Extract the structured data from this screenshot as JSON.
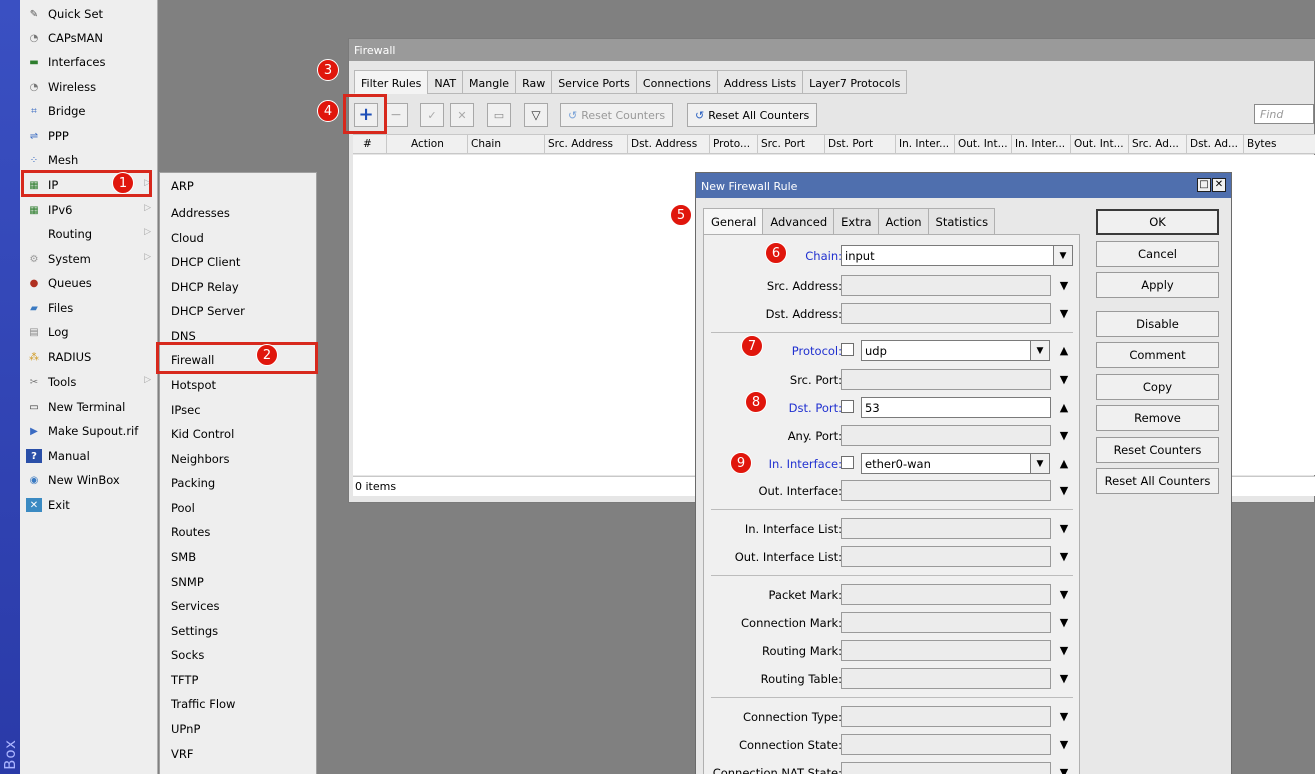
{
  "app": {
    "vertical_label": "Box"
  },
  "main_menu": [
    {
      "label": "Quick Set",
      "icon": "quick-set-icon",
      "glyph": "✎",
      "arrow": false
    },
    {
      "label": "CAPsMAN",
      "icon": "capsman-icon",
      "glyph": "◔",
      "arrow": false
    },
    {
      "label": "Interfaces",
      "icon": "interfaces-icon",
      "glyph": "▬",
      "arrow": false
    },
    {
      "label": "Wireless",
      "icon": "wireless-icon",
      "glyph": "◔",
      "arrow": false
    },
    {
      "label": "Bridge",
      "icon": "bridge-icon",
      "glyph": "⌗",
      "arrow": false
    },
    {
      "label": "PPP",
      "icon": "ppp-icon",
      "glyph": "⇌",
      "arrow": false
    },
    {
      "label": "Mesh",
      "icon": "mesh-icon",
      "glyph": "⁘",
      "arrow": false
    },
    {
      "label": "IP",
      "icon": "ip-icon",
      "glyph": "▦",
      "arrow": true
    },
    {
      "label": "IPv6",
      "icon": "ipv6-icon",
      "glyph": "▦",
      "arrow": true
    },
    {
      "label": "Routing",
      "icon": "",
      "glyph": "",
      "arrow": true
    },
    {
      "label": "System",
      "icon": "system-icon",
      "glyph": "⚙",
      "arrow": true
    },
    {
      "label": "Queues",
      "icon": "queues-icon",
      "glyph": "●",
      "arrow": false
    },
    {
      "label": "Files",
      "icon": "files-icon",
      "glyph": "▰",
      "arrow": false
    },
    {
      "label": "Log",
      "icon": "log-icon",
      "glyph": "▤",
      "arrow": false
    },
    {
      "label": "RADIUS",
      "icon": "radius-icon",
      "glyph": "⁂",
      "arrow": false
    },
    {
      "label": "Tools",
      "icon": "tools-icon",
      "glyph": "✂",
      "arrow": true
    },
    {
      "label": "New Terminal",
      "icon": "terminal-icon",
      "glyph": "▭",
      "arrow": false
    },
    {
      "label": "Make Supout.rif",
      "icon": "supout-icon",
      "glyph": "▶",
      "arrow": false
    },
    {
      "label": "Manual",
      "icon": "manual-icon",
      "glyph": "?",
      "arrow": false
    },
    {
      "label": "New WinBox",
      "icon": "winbox-icon",
      "glyph": "◉",
      "arrow": false
    },
    {
      "label": "Exit",
      "icon": "exit-icon",
      "glyph": "✕",
      "arrow": false
    }
  ],
  "ip_submenu": [
    "ARP",
    "Addresses",
    "Cloud",
    "DHCP Client",
    "DHCP Relay",
    "DHCP Server",
    "DNS",
    "Firewall",
    "Hotspot",
    "IPsec",
    "Kid Control",
    "Neighbors",
    "Packing",
    "Pool",
    "Routes",
    "SMB",
    "SNMP",
    "Services",
    "Settings",
    "Socks",
    "TFTP",
    "Traffic Flow",
    "UPnP",
    "VRF"
  ],
  "firewall": {
    "title": "Firewall",
    "tabs": [
      "Filter Rules",
      "NAT",
      "Mangle",
      "Raw",
      "Service Ports",
      "Connections",
      "Address Lists",
      "Layer7 Protocols"
    ],
    "reset_counters": "Reset Counters",
    "reset_all_counters": "Reset All Counters",
    "find_placeholder": "Find",
    "columns": [
      "#",
      "Action",
      "Chain",
      "Src. Address",
      "Dst. Address",
      "Proto...",
      "Src. Port",
      "Dst. Port",
      "In. Inter...",
      "Out. Int...",
      "In. Inter...",
      "Out. Int...",
      "Src. Ad...",
      "Dst. Ad...",
      "Bytes"
    ],
    "status": "0 items"
  },
  "dialog": {
    "title": "New Firewall Rule",
    "tabs": [
      "General",
      "Advanced",
      "Extra",
      "Action",
      "Statistics"
    ],
    "fields": {
      "chain": {
        "label": "Chain:",
        "value": "input"
      },
      "src_address": {
        "label": "Src. Address:"
      },
      "dst_address": {
        "label": "Dst. Address:"
      },
      "protocol": {
        "label": "Protocol:",
        "value": "udp"
      },
      "src_port": {
        "label": "Src. Port:"
      },
      "dst_port": {
        "label": "Dst. Port:",
        "value": "53"
      },
      "any_port": {
        "label": "Any. Port:"
      },
      "in_interface": {
        "label": "In. Interface:",
        "value": "ether0-wan"
      },
      "out_interface": {
        "label": "Out. Interface:"
      },
      "in_interface_list": {
        "label": "In. Interface List:"
      },
      "out_interface_list": {
        "label": "Out. Interface List:"
      },
      "packet_mark": {
        "label": "Packet Mark:"
      },
      "connection_mark": {
        "label": "Connection Mark:"
      },
      "routing_mark": {
        "label": "Routing Mark:"
      },
      "routing_table": {
        "label": "Routing Table:"
      },
      "connection_type": {
        "label": "Connection Type:"
      },
      "connection_state": {
        "label": "Connection State:"
      },
      "connection_nat_state": {
        "label": "Connection NAT State:"
      }
    },
    "buttons": [
      "OK",
      "Cancel",
      "Apply",
      "Disable",
      "Comment",
      "Copy",
      "Remove",
      "Reset Counters",
      "Reset All Counters"
    ]
  },
  "annotations": [
    "1",
    "2",
    "3",
    "4",
    "5",
    "6",
    "7",
    "8",
    "9"
  ],
  "colors": {
    "highlight": "#d7281c",
    "badge": "#e0160c",
    "dialog_title": "#4f6fae",
    "field_label_blue": "#2030d0"
  }
}
